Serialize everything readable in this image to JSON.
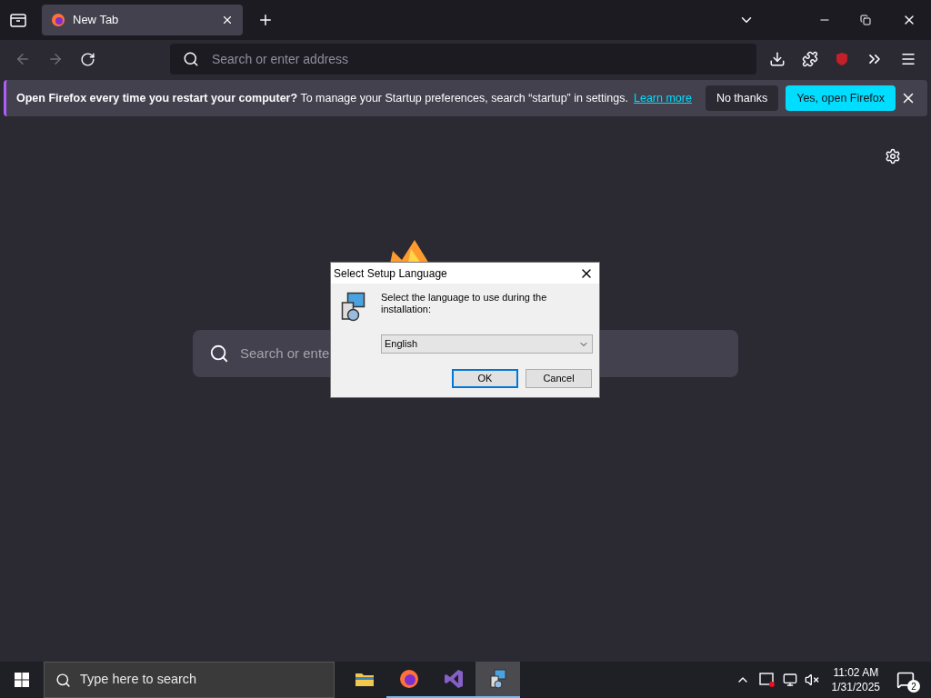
{
  "tabs": [
    {
      "title": "New Tab",
      "selected": true
    }
  ],
  "address_bar": {
    "placeholder": "Search or enter address"
  },
  "notification": {
    "bold": "Open Firefox every time you restart your computer?",
    "text": "To manage your Startup preferences, search “startup” in settings.",
    "link": "Learn more",
    "buttons": [
      {
        "label": "No thanks",
        "kind": "secondary"
      },
      {
        "label": "Yes, open Firefox",
        "kind": "primary"
      }
    ]
  },
  "new_tab": {
    "search_placeholder": "Search or ente"
  },
  "dialog": {
    "title": "Select Setup Language",
    "message": "Select the language to use during the installation:",
    "language": "English",
    "buttons": [
      {
        "label": "OK",
        "selected": true
      },
      {
        "label": "Cancel",
        "selected": false
      }
    ]
  },
  "taskbar": {
    "search_placeholder": "Type here to search",
    "apps": [
      {
        "kind": "explorer",
        "running": false,
        "active": false
      },
      {
        "kind": "firefox",
        "running": true,
        "active": false
      },
      {
        "kind": "visualstudio",
        "running": true,
        "active": false
      },
      {
        "kind": "setup",
        "running": true,
        "active": true
      }
    ],
    "time": "11:02 AM",
    "date": "1/31/2025",
    "notifications": "2"
  }
}
